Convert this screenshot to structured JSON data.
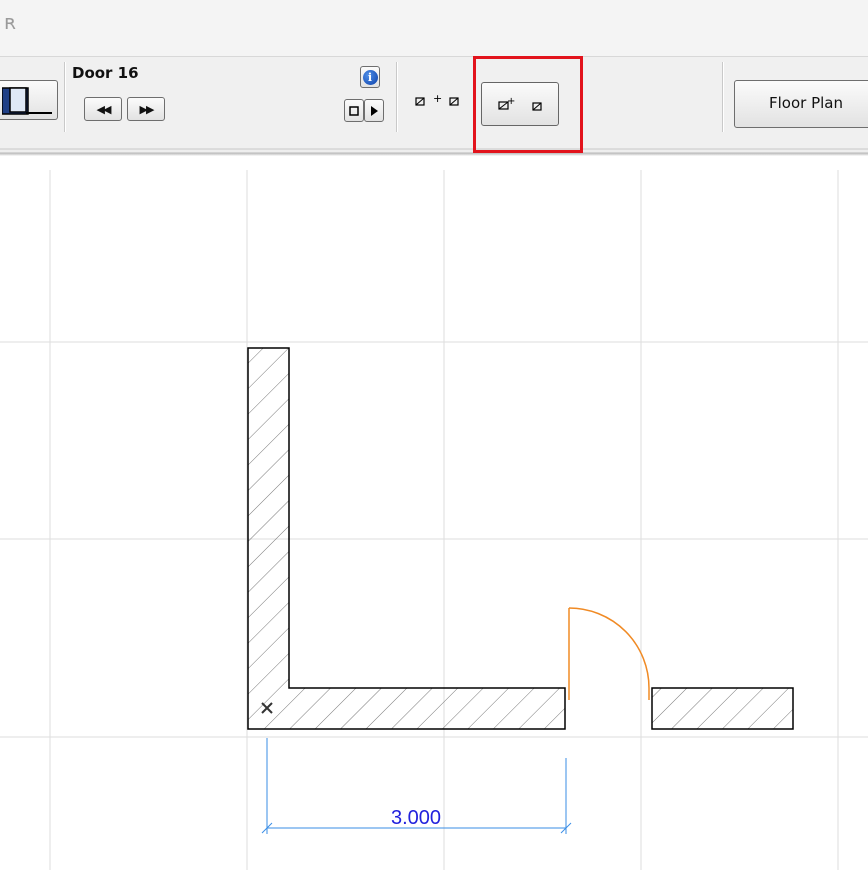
{
  "window": {
    "title_glyph": "ʀ"
  },
  "toolbar": {
    "element_name": "Door 16",
    "prev_button_glyph": "◀◀",
    "next_button_glyph": "▶▶",
    "info_glyph": "i",
    "stop_button_glyph": "□",
    "play_button_glyph": "▶",
    "view_button_label": "Floor Plan",
    "highlight_color": "#e2131c"
  },
  "drawing": {
    "dimension_label": "3.000",
    "dimension_color": "#3a8ee6",
    "dimension_text_color": "#2222dd",
    "door_swing_color": "#f08a24",
    "grid_color": "#dddddd",
    "wall_color": "#000000"
  }
}
